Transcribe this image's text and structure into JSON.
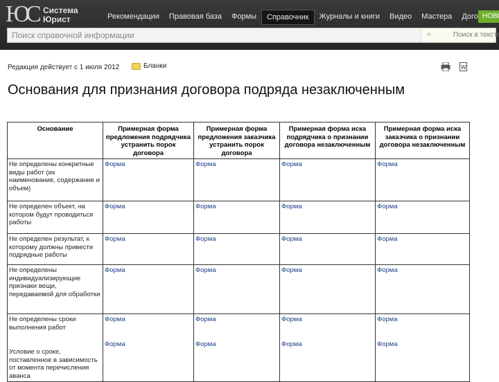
{
  "header": {
    "logo_mark": "ЮС",
    "brand_line1": "Система",
    "brand_line2": "Юрист",
    "nav": [
      {
        "label": "Рекомендации"
      },
      {
        "label": "Правовая база"
      },
      {
        "label": "Формы"
      },
      {
        "label": "Справочник",
        "active": true
      },
      {
        "label": "Журналы и книги"
      },
      {
        "label": "Видео"
      },
      {
        "label": "Мастера"
      },
      {
        "label": "Договоры"
      }
    ],
    "badge": "НОВО"
  },
  "search": {
    "placeholder": "Поиск справочной информации",
    "scope_arrow": "«",
    "scope_label": "Поиск в тексте"
  },
  "info": {
    "edition": "Редакция действует с 1 июля 2012",
    "forms_link": "Бланки"
  },
  "page_title": "Основания для признания договора подряда незаключенным",
  "table": {
    "headers": [
      "Основание",
      "Примерная форма предложения подрядчика устранить порок договора",
      "Примерная форма предложения заказчика устранить порок договора",
      "Примерная форма иска подрядчика о признании договора незаключенным",
      "Примерная форма иска заказчика о признании договора незаключенным"
    ],
    "link_label": "Форма",
    "rows": [
      {
        "reason": "Не определены конкретные виды работ (их наименование, содержание и объем)"
      },
      {
        "reason": "Не определен объект, на котором будут проводиться работы"
      },
      {
        "reason": "Не определен результат, к которому должны привести подрядные работы"
      },
      {
        "reason": "Не определены индивидуализирующие признаки вещи, передаваемой для обработки"
      },
      {
        "reason": "Не определены сроки выполнения работ",
        "sub": "Условие о сроке, поставленное в зависимость от момента перечисления аванса"
      }
    ]
  },
  "colors": {
    "header_bg": "#2e2e2e",
    "badge": "#6fae2d",
    "link": "#1a3f8a",
    "folder": "#f2d25c"
  }
}
